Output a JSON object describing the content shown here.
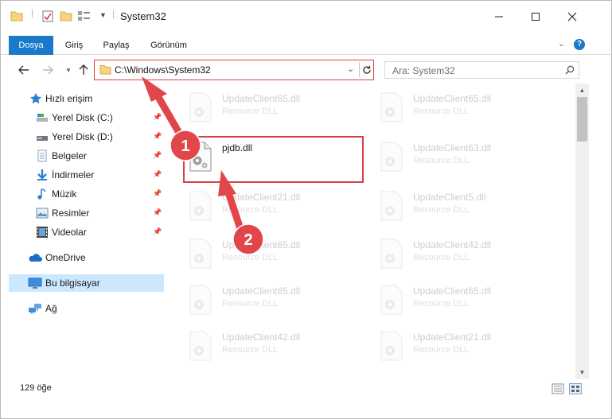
{
  "window": {
    "title": "System32",
    "minimize_label": "—",
    "maximize_label": "☐",
    "close_label": "✕"
  },
  "ribbon": {
    "tabs": [
      "Dosya",
      "Giriş",
      "Paylaş",
      "Görünüm"
    ],
    "help_label": "?"
  },
  "addressbar": {
    "path": "C:\\Windows\\System32",
    "search_placeholder": "Ara: System32"
  },
  "nav": {
    "quick_access": "Hızlı erişim",
    "items": [
      {
        "label": "Yerel Disk (C:)",
        "icon": "drive-icon",
        "pinned": true
      },
      {
        "label": "Yerel Disk (D:)",
        "icon": "drive-icon",
        "pinned": true
      },
      {
        "label": "Belgeler",
        "icon": "documents-icon",
        "pinned": true
      },
      {
        "label": "İndirmeler",
        "icon": "downloads-icon",
        "pinned": true
      },
      {
        "label": "Müzik",
        "icon": "music-icon",
        "pinned": true
      },
      {
        "label": "Resimler",
        "icon": "pictures-icon",
        "pinned": true
      },
      {
        "label": "Videolar",
        "icon": "videos-icon",
        "pinned": true
      }
    ],
    "onedrive": "OneDrive",
    "this_pc": "Bu bilgisayar",
    "network": "Ağ"
  },
  "files": {
    "highlighted": {
      "name": "pjdb.dll"
    },
    "left": [
      {
        "name": "UpdateClient65.dll",
        "desc": "Resource DLL"
      },
      {
        "name": "",
        "desc": ""
      },
      {
        "name": "UpdateClient21.dll",
        "desc": "Resource DLL"
      },
      {
        "name": "UpdateClient65.dll",
        "desc": "Resource DLL"
      },
      {
        "name": "UpdateClient65.dll",
        "desc": "Resource DLL"
      },
      {
        "name": "UpdateClient42.dll",
        "desc": "Resource DLL"
      }
    ],
    "right": [
      {
        "name": "UpdateClient65.dll",
        "desc": "Resource DLL"
      },
      {
        "name": "UpdateClient63.dll",
        "desc": "Resource DLL"
      },
      {
        "name": "UpdateClient5.dll",
        "desc": "Resource DLL"
      },
      {
        "name": "UpdateClient42.dll",
        "desc": "Resource DLL"
      },
      {
        "name": "UpdateClient65.dll",
        "desc": "Resource DLL"
      },
      {
        "name": "UpdateClient21.dll",
        "desc": "Resource DLL"
      }
    ]
  },
  "status": {
    "count": "129 öğe"
  },
  "annotations": {
    "callout1": "1",
    "callout2": "2",
    "color": "#d94044"
  }
}
